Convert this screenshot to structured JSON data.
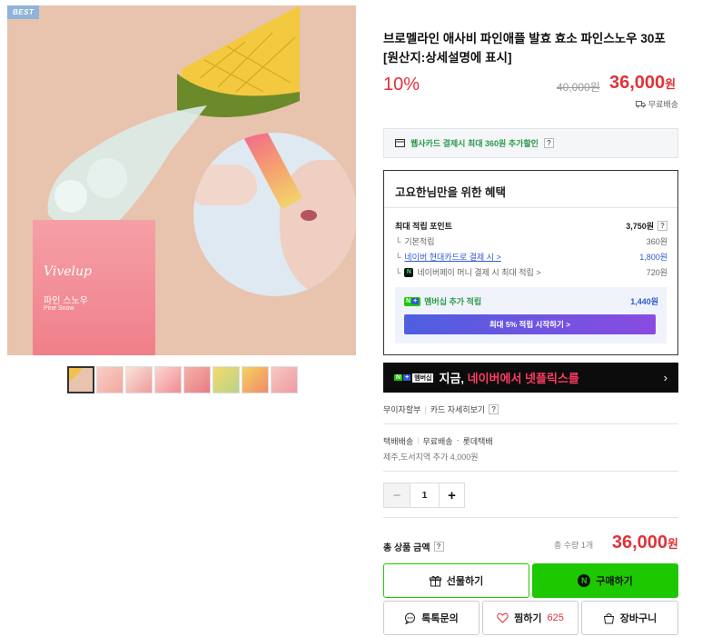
{
  "product": {
    "badge": "BEST",
    "title": "브로멜라인 애사비 파인애플 발효 효소 파인스노우 30포 [원산지:상세설명에 표시]",
    "discount_rate": "10%",
    "original_price": "40,000원",
    "sale_price": "36,000",
    "sale_price_unit": "원",
    "shipping_free": "무료배송",
    "box_brand": "Vivelup",
    "box_name": "파인 스노우",
    "box_sub": "Pine Snow"
  },
  "card_promo": {
    "text": "웹사카드 결제시 최대 360원 추가할인",
    "help": "?"
  },
  "benefit": {
    "title": "고요한님만을 위한 혜택",
    "max_points_label": "최대 적립 포인트",
    "max_points_value": "3,750원",
    "rows": [
      {
        "label": "기본적립",
        "value": "360원"
      },
      {
        "label": "네이버 현대카드로 결제 시 >",
        "value": "1,800원"
      },
      {
        "label": "네이버페이 머니 결제 시 최대 적립 >",
        "value": "720원"
      }
    ],
    "member_label": "멤버십 추가 적립",
    "member_value": "1,440원",
    "member_button": "최대 5% 적립 시작하기 >"
  },
  "banner": {
    "logo_n": "N",
    "logo_plus": "+",
    "logo_m": "멤버십",
    "text_plain": "지금, ",
    "text_highlight": "네이버에서 넷플릭스를",
    "arrow": "›"
  },
  "installment": {
    "label1": "무이자할부",
    "label2": "카드 자세히보기",
    "help": "?"
  },
  "shipping": {
    "type": "택배배송",
    "fee": "무료배송",
    "carrier": "롯데택배",
    "extra": "제주,도서지역 추가 4,000원"
  },
  "quantity": {
    "minus": "−",
    "value": "1",
    "plus": "+"
  },
  "total": {
    "label": "총 상품 금액",
    "help": "?",
    "count": "총 수량 1개",
    "price": "36,000",
    "unit": "원"
  },
  "buttons": {
    "gift": "선물하기",
    "buy": "구매하기",
    "talk": "톡톡문의",
    "wish": "찜하기",
    "wish_count": "625",
    "cart": "장바구니"
  },
  "colors": {
    "accent_red": "#e0323a",
    "naver_green": "#1ec800",
    "link_blue": "#2f5bd6"
  }
}
